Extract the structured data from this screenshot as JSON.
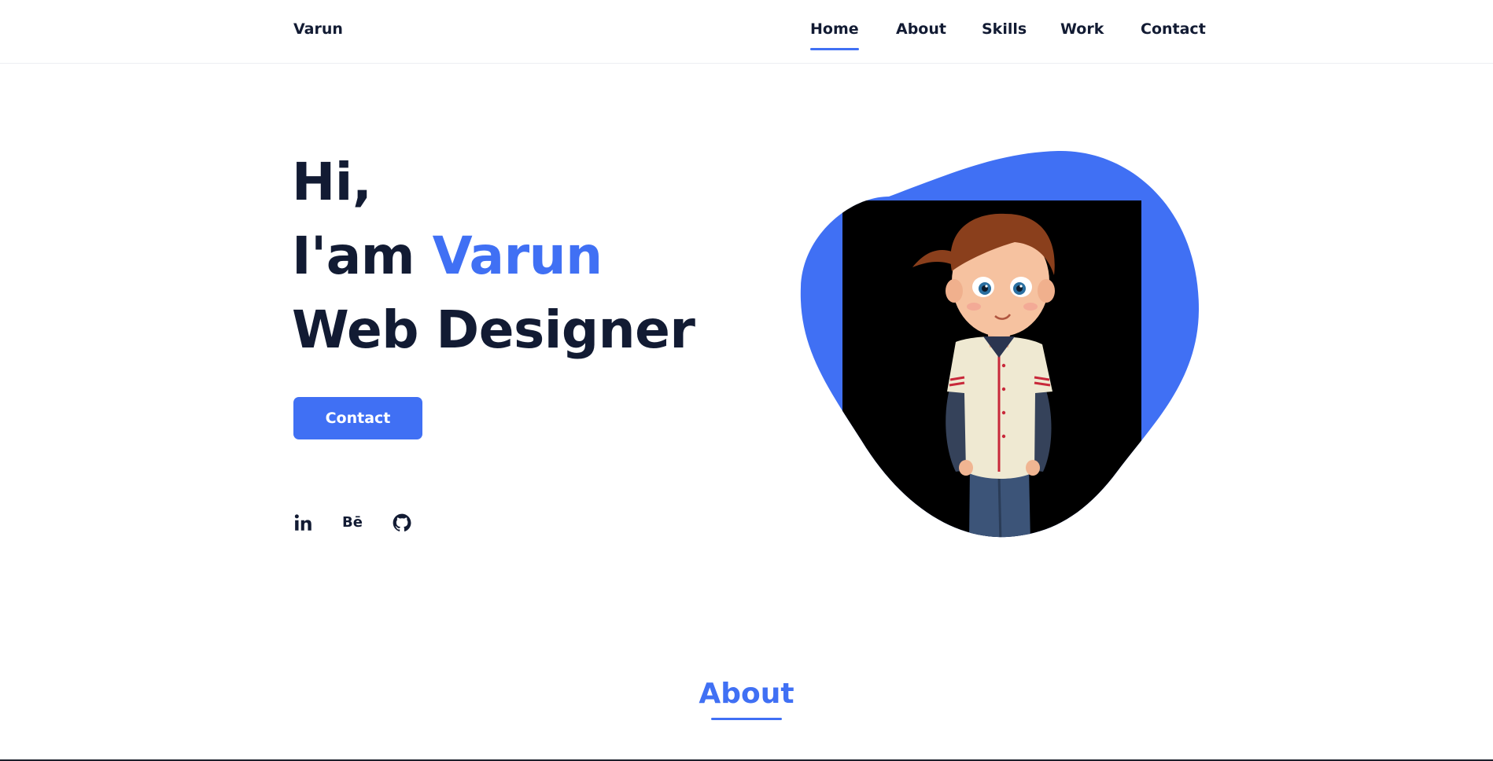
{
  "header": {
    "logo": "Varun",
    "nav": [
      {
        "label": "Home",
        "active": true
      },
      {
        "label": "About",
        "active": false
      },
      {
        "label": "Skills",
        "active": false
      },
      {
        "label": "Work",
        "active": false
      },
      {
        "label": "Contact",
        "active": false
      }
    ]
  },
  "hero": {
    "line1": "Hi,",
    "line2_prefix": "I'am ",
    "line2_name": "Varun",
    "line3": "Web Designer",
    "button_label": "Contact",
    "social_icons": [
      "linkedin-icon",
      "behance-icon",
      "github-icon"
    ],
    "behance_text": "Bē"
  },
  "about": {
    "title": "About"
  },
  "colors": {
    "accent": "#4070f4",
    "text": "#121b33"
  }
}
